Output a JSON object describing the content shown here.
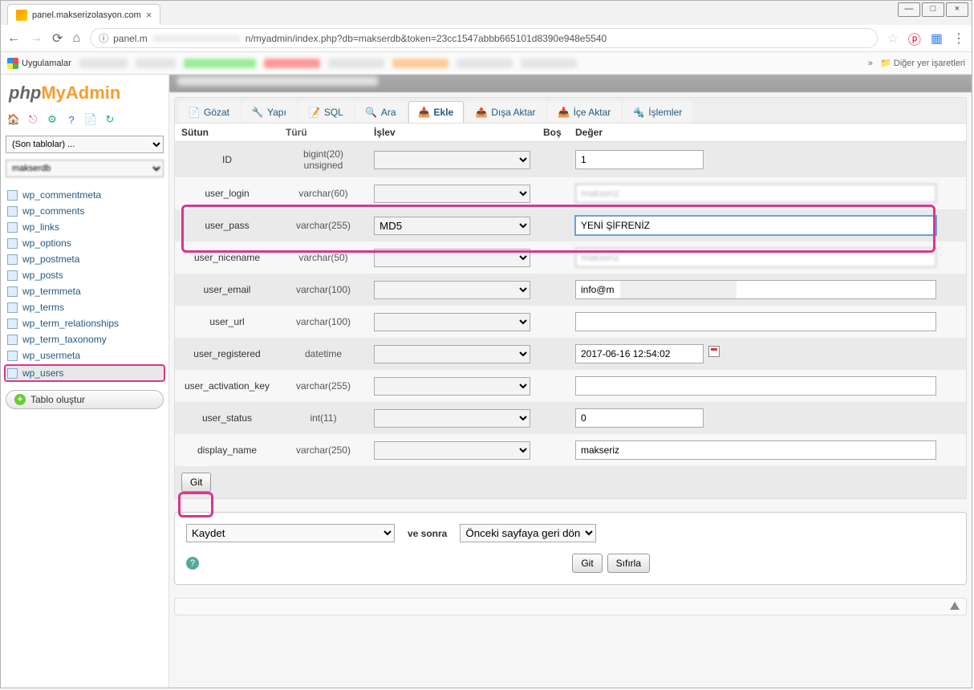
{
  "browser": {
    "tab_title": "panel.makserizolasyon.com",
    "url_prefix": "panel.m",
    "url_suffix": "n/myadmin/index.php?db=makserdb&token=23cc1547abbb665101d8390e948e5540",
    "bookmarks_label": "Uygulamalar",
    "more_bookmarks": "Diğer yer işaretleri"
  },
  "sidebar": {
    "recent_placeholder": "(Son tablolar) ...",
    "db_blur": "makserdb",
    "tables": [
      "wp_commentmeta",
      "wp_comments",
      "wp_links",
      "wp_options",
      "wp_postmeta",
      "wp_posts",
      "wp_termmeta",
      "wp_terms",
      "wp_term_relationships",
      "wp_term_taxonomy",
      "wp_usermeta",
      "wp_users"
    ],
    "selected_table": "wp_users",
    "create_table": "Tablo oluştur"
  },
  "tabs": {
    "browse": "Gözat",
    "structure": "Yapı",
    "sql": "SQL",
    "search": "Ara",
    "insert": "Ekle",
    "export": "Dışa Aktar",
    "import": "İçe Aktar",
    "operations": "İşlemler"
  },
  "headers": {
    "column": "Sütun",
    "type": "Türü",
    "function": "İşlev",
    "null": "Boş",
    "value": "Değer"
  },
  "rows": [
    {
      "name": "ID",
      "type": "bigint(20) unsigned",
      "func": "",
      "value": "1",
      "cls": "odd",
      "len": "short"
    },
    {
      "name": "user_login",
      "type": "varchar(60)",
      "func": "",
      "value": "makseriz",
      "cls": "even",
      "len": "long",
      "blur": true
    },
    {
      "name": "user_pass",
      "type": "varchar(255)",
      "func": "MD5",
      "value": "YENİ ŞİFRENİZ",
      "cls": "odd",
      "len": "long",
      "highlight": true
    },
    {
      "name": "user_nicename",
      "type": "varchar(50)",
      "func": "",
      "value": "makseriz",
      "cls": "even",
      "len": "long",
      "blur": true
    },
    {
      "name": "user_email",
      "type": "varchar(100)",
      "func": "",
      "value": "info@makserizolasyon.com",
      "cls": "odd",
      "len": "long",
      "partial_blur": true,
      "visible": "info@m"
    },
    {
      "name": "user_url",
      "type": "varchar(100)",
      "func": "",
      "value": "",
      "cls": "even",
      "len": "long"
    },
    {
      "name": "user_registered",
      "type": "datetime",
      "func": "",
      "value": "2017-06-16 12:54:02",
      "cls": "odd",
      "len": "short",
      "cal": true
    },
    {
      "name": "user_activation_key",
      "type": "varchar(255)",
      "func": "",
      "value": "",
      "cls": "even",
      "len": "long"
    },
    {
      "name": "user_status",
      "type": "int(11)",
      "func": "",
      "value": "0",
      "cls": "odd",
      "len": "short"
    },
    {
      "name": "display_name",
      "type": "varchar(250)",
      "func": "",
      "value": "makseriz",
      "cls": "even",
      "len": "long"
    }
  ],
  "buttons": {
    "go": "Git",
    "reset": "Sıfırla"
  },
  "bottom": {
    "save_option": "Kaydet",
    "and_then": "ve sonra",
    "after_option": "Önceki sayfaya geri dön"
  }
}
